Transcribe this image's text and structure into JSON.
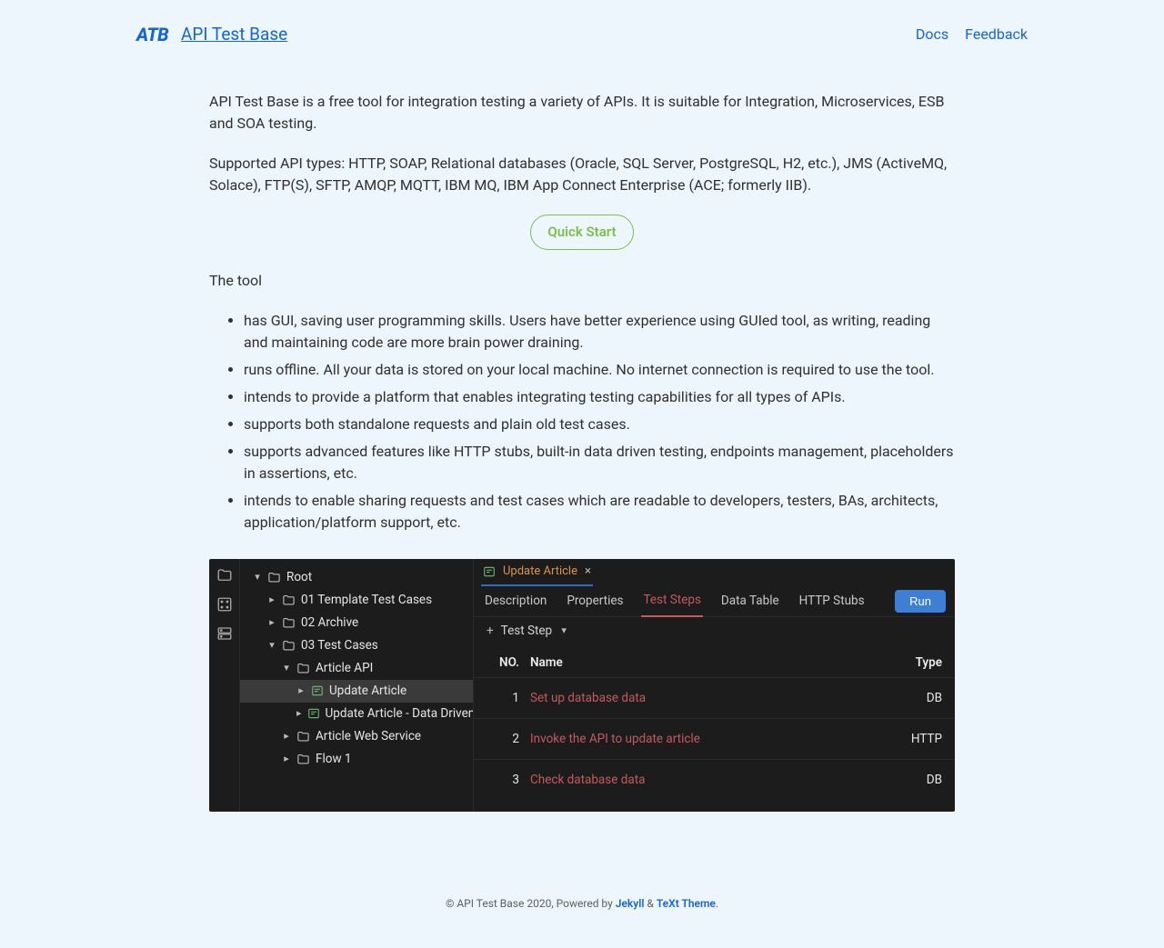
{
  "header": {
    "logo": "ATB",
    "title": "API Test Base",
    "nav": {
      "docs": "Docs",
      "feedback": "Feedback"
    }
  },
  "intro": {
    "p1": "API Test Base is a free tool for integration testing a variety of APIs. It is suitable for Integration, Microservices, ESB and SOA testing.",
    "p2": "Supported API types: HTTP, SOAP, Relational databases (Oracle, SQL Server, PostgreSQL, H2, etc.), JMS (ActiveMQ, Solace), FTP(S), SFTP, AMQP, MQTT, IBM MQ, IBM App Connect Enterprise (ACE; formerly IIB).",
    "quick_start": "Quick Start",
    "tool_lead": "The tool",
    "bullets": [
      "has GUI, saving user programming skills. Users have better experience using GUIed tool, as writing, reading and maintaining code are more brain power draining.",
      "runs offline. All your data is stored on your local machine. No internet connection is required to use the tool.",
      "intends to provide a platform that enables integrating testing capabilities for all types of APIs.",
      "supports both standalone requests and plain old test cases.",
      "supports advanced features like HTTP stubs, built-in data driven testing, endpoints management, placeholders in assertions, etc.",
      "intends to enable sharing requests and test cases which are readable to developers, testers, BAs, architects, application/platform support, etc."
    ]
  },
  "screenshot": {
    "tree": {
      "root": "Root",
      "nodes": [
        "01 Template Test Cases",
        "02 Archive",
        "03 Test Cases",
        "Article API",
        "Update Article",
        "Update Article - Data Driven",
        "Article Web Service",
        "Flow 1"
      ]
    },
    "tab_title": "Update Article",
    "subtabs": [
      "Description",
      "Properties",
      "Test Steps",
      "Data Table",
      "HTTP Stubs"
    ],
    "run": "Run",
    "add_step": "Test Step",
    "table": {
      "head": {
        "no": "NO.",
        "name": "Name",
        "type": "Type"
      },
      "rows": [
        {
          "no": "1",
          "name": "Set up database data",
          "type": "DB"
        },
        {
          "no": "2",
          "name": "Invoke the API to update article",
          "type": "HTTP"
        },
        {
          "no": "3",
          "name": "Check database data",
          "type": "DB"
        }
      ]
    }
  },
  "footer": {
    "prefix": "© API Test Base 2020, Powered by ",
    "jekyll": "Jekyll",
    "amp": " & ",
    "text_theme": "TeXt Theme",
    "suffix": "."
  }
}
